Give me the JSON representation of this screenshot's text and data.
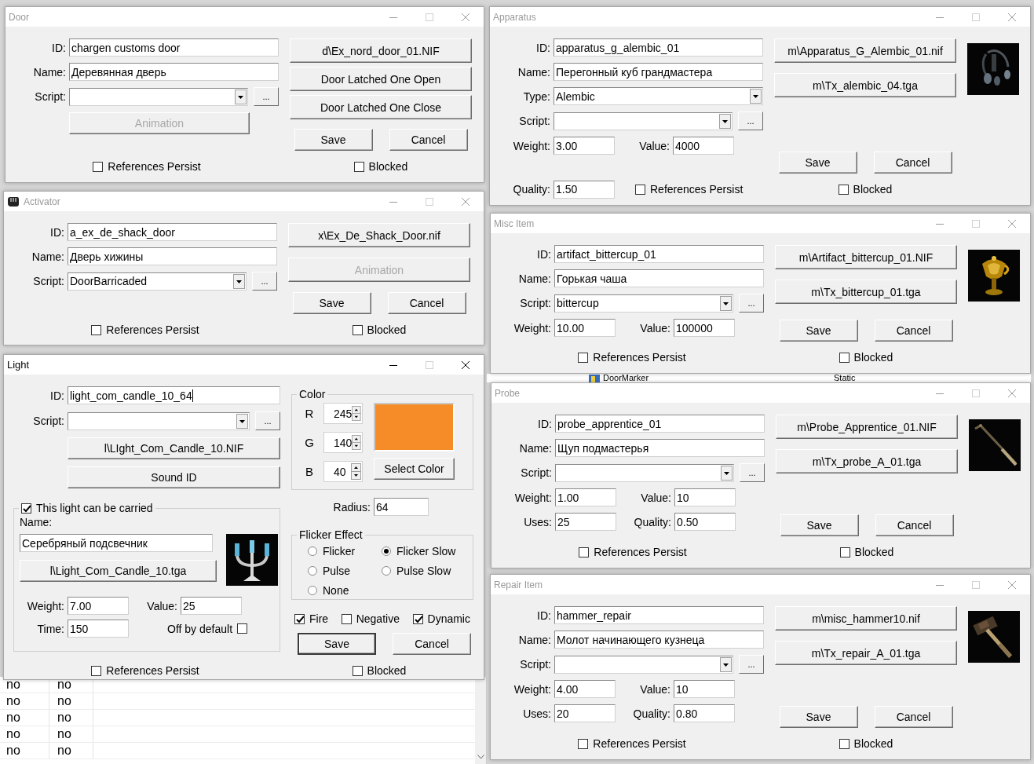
{
  "background": {
    "list_rows": [
      {
        "cells": [
          "no",
          "no"
        ]
      },
      {
        "cells": [
          "no",
          "no"
        ]
      },
      {
        "cells": [
          "no",
          "no"
        ]
      },
      {
        "cells": [
          "no",
          "no"
        ]
      },
      {
        "cells": [
          "no",
          "no"
        ]
      }
    ],
    "strip_row": {
      "cells": [
        "DoorMarker",
        "Static"
      ]
    }
  },
  "windows": [
    {
      "kind": "door",
      "title": "Door",
      "active": false,
      "has_icon": false,
      "left": [
        {
          "kind": "field",
          "label": "ID:",
          "value": "chargen customs door"
        },
        {
          "kind": "field",
          "label": "Name:",
          "value": "Деревянная дверь"
        },
        {
          "kind": "combo",
          "label": "Script:",
          "browse": "..."
        },
        {
          "kind": "button",
          "label": "Animation",
          "disabled": true
        }
      ],
      "right": [
        {
          "kind": "button",
          "label": "d\\Ex_nord_door_01.NIF",
          "disabled": false
        },
        {
          "kind": "button",
          "label": "Door Latched One Open",
          "disabled": false
        },
        {
          "kind": "button",
          "label": "Door Latched One Close",
          "disabled": false
        },
        {
          "kind": "actions",
          "buttons": [
            {
              "label": "Save",
              "default": false
            },
            {
              "label": "Cancel",
              "default": false
            }
          ]
        }
      ],
      "footer": {
        "left": [
          {
            "kind": "check",
            "label": "References Persist",
            "checked": false
          }
        ],
        "right": [
          {
            "kind": "check",
            "label": "Blocked",
            "checked": false
          }
        ]
      }
    },
    {
      "kind": "apparatus",
      "title": "Apparatus",
      "active": false,
      "has_icon": false,
      "left": [
        {
          "kind": "field",
          "label": "ID:",
          "value": "apparatus_g_alembic_01"
        },
        {
          "kind": "field",
          "label": "Name:",
          "value": "Перегонный куб грандмастера"
        },
        {
          "kind": "combo",
          "label": "Type:",
          "value": "Alembic"
        },
        {
          "kind": "combo",
          "label": "Script:",
          "browse": "..."
        },
        {
          "kind": "row",
          "items": [
            {
              "kind": "field",
              "label": "Weight:",
              "value": "3.00"
            },
            {
              "kind": "field",
              "label": "Value:",
              "value": "4000"
            }
          ]
        }
      ],
      "right": [
        {
          "kind": "button",
          "label": "m\\Apparatus_G_Alembic_01.nif",
          "disabled": false
        },
        {
          "kind": "button",
          "label": "m\\Tx_alembic_04.tga",
          "disabled": false
        },
        {
          "kind": "actions",
          "buttons": [
            {
              "label": "Save",
              "default": false
            },
            {
              "label": "Cancel",
              "default": false
            }
          ]
        }
      ],
      "picture": {
        "kind": "picture"
      },
      "footer": {
        "left": [
          {
            "kind": "row",
            "items": [
              {
                "kind": "field",
                "label": "Quality:",
                "value": "1.50"
              },
              {
                "kind": "check",
                "label": "References Persist",
                "checked": false
              }
            ]
          }
        ],
        "right": [
          {
            "kind": "check",
            "label": "Blocked",
            "checked": false
          }
        ]
      }
    },
    {
      "kind": "activator",
      "title": "Activator",
      "active": false,
      "has_icon": true,
      "left": [
        {
          "kind": "field",
          "label": "ID:",
          "value": "a_ex_de_shack_door"
        },
        {
          "kind": "field",
          "label": "Name:",
          "value": "Дверь хижины"
        },
        {
          "kind": "combo",
          "label": "Script:",
          "value": "DoorBarricaded",
          "browse": "..."
        }
      ],
      "right": [
        {
          "kind": "button",
          "label": "x\\Ex_De_Shack_Door.nif",
          "disabled": false
        },
        {
          "kind": "button",
          "label": "Animation",
          "disabled": true
        },
        {
          "kind": "actions",
          "buttons": [
            {
              "label": "Save",
              "default": false
            },
            {
              "label": "Cancel",
              "default": false
            }
          ]
        }
      ],
      "footer": {
        "left": [
          {
            "kind": "check",
            "label": "References Persist",
            "checked": false
          }
        ],
        "right": [
          {
            "kind": "check",
            "label": "Blocked",
            "checked": false
          }
        ]
      }
    },
    {
      "kind": "misc",
      "title": "Misc Item",
      "active": false,
      "has_icon": false,
      "left": [
        {
          "kind": "field",
          "label": "ID:",
          "value": "artifact_bittercup_01"
        },
        {
          "kind": "field",
          "label": "Name:",
          "value": "Горькая чаша"
        },
        {
          "kind": "combo",
          "label": "Script:",
          "value": "bittercup",
          "browse": "..."
        },
        {
          "kind": "row",
          "items": [
            {
              "kind": "field",
              "label": "Weight:",
              "value": "10.00"
            },
            {
              "kind": "field",
              "label": "Value:",
              "value": "100000"
            }
          ]
        }
      ],
      "right": [
        {
          "kind": "button",
          "label": "m\\Artifact_bittercup_01.NIF",
          "disabled": false
        },
        {
          "kind": "button",
          "label": "m\\Tx_bittercup_01.tga",
          "disabled": false
        },
        {
          "kind": "actions",
          "buttons": [
            {
              "label": "Save",
              "default": false
            },
            {
              "label": "Cancel",
              "default": false
            }
          ]
        }
      ],
      "picture": {
        "kind": "picture"
      },
      "footer": {
        "left": [
          {
            "kind": "check",
            "label": "References Persist",
            "checked": false
          }
        ],
        "right": [
          {
            "kind": "check",
            "label": "Blocked",
            "checked": false
          }
        ]
      }
    },
    {
      "kind": "light",
      "title": "Light",
      "active": true,
      "has_icon": false,
      "left": [
        {
          "kind": "field",
          "label": "ID:",
          "value": "light_com_candle_10_64",
          "focused": true
        },
        {
          "kind": "combo",
          "label": "Script:",
          "browse": "..."
        },
        {
          "kind": "button",
          "label": "l\\LIght_Com_Candle_10.NIF",
          "disabled": false
        },
        {
          "kind": "button",
          "label": "Sound ID",
          "disabled": false
        },
        {
          "kind": "group",
          "title": {
            "kind": "check",
            "label": "This light can be carried",
            "checked": true
          },
          "items": [
            {
              "kind": "text",
              "text": "Name:"
            },
            {
              "kind": "row",
              "items": [
                {
                  "kind": "col",
                  "items": [
                    {
                      "kind": "field",
                      "value": "Серебряный подсвечник"
                    },
                    {
                      "kind": "button",
                      "label": "l\\Light_Com_Candle_10.tga",
                      "disabled": false
                    }
                  ]
                },
                {
                  "kind": "picture"
                }
              ]
            },
            {
              "kind": "row",
              "items": [
                {
                  "kind": "field",
                  "label": "Weight:",
                  "value": "7.00"
                },
                {
                  "kind": "field",
                  "label": "Value:",
                  "value": "25"
                }
              ]
            },
            {
              "kind": "row",
              "items": [
                {
                  "kind": "field",
                  "label": "Time:",
                  "value": "150"
                },
                {
                  "kind": "trailing-check",
                  "label": "Off by default",
                  "checked": false
                }
              ]
            }
          ]
        }
      ],
      "right": [
        {
          "kind": "group",
          "title": {
            "kind": "text",
            "text": "Color"
          },
          "items": [
            {
              "kind": "row",
              "items": [
                {
                  "kind": "col",
                  "items": [
                    {
                      "kind": "spin",
                      "label": "R",
                      "value": "245"
                    },
                    {
                      "kind": "spin",
                      "label": "G",
                      "value": "140"
                    },
                    {
                      "kind": "spin",
                      "label": "B",
                      "value": "40"
                    }
                  ]
                },
                {
                  "kind": "col",
                  "items": [
                    {
                      "kind": "swatch",
                      "color": "#f58c28"
                    },
                    {
                      "kind": "button",
                      "label": "Select Color",
                      "disabled": false
                    }
                  ]
                }
              ]
            }
          ]
        },
        {
          "kind": "field",
          "label": "Radius:",
          "value": "64"
        },
        {
          "kind": "group",
          "title": {
            "kind": "text",
            "text": "Flicker Effect"
          },
          "items": [
            {
              "kind": "radio-grid",
              "options": [
                {
                  "label": "Flicker",
                  "selected": false
                },
                {
                  "label": "Flicker Slow",
                  "selected": true
                },
                {
                  "label": "Pulse",
                  "selected": false
                },
                {
                  "label": "Pulse Slow",
                  "selected": false
                },
                {
                  "label": "None",
                  "selected": false
                }
              ]
            }
          ]
        },
        {
          "kind": "row",
          "items": [
            {
              "kind": "check",
              "label": "Fire",
              "checked": true
            },
            {
              "kind": "check",
              "label": "Negative",
              "checked": false
            },
            {
              "kind": "check",
              "label": "Dynamic",
              "checked": true
            }
          ]
        },
        {
          "kind": "actions",
          "buttons": [
            {
              "label": "Save",
              "default": true
            },
            {
              "label": "Cancel",
              "default": false
            }
          ]
        }
      ],
      "footer": {
        "left": [
          {
            "kind": "check",
            "label": "References Persist",
            "checked": false
          }
        ],
        "right": [
          {
            "kind": "check",
            "label": "Blocked",
            "checked": false
          }
        ]
      }
    },
    {
      "kind": "probe",
      "title": "Probe",
      "active": false,
      "has_icon": false,
      "left": [
        {
          "kind": "field",
          "label": "ID:",
          "value": "probe_apprentice_01"
        },
        {
          "kind": "field",
          "label": "Name:",
          "value": "Щуп подмастерья"
        },
        {
          "kind": "combo",
          "label": "Script:",
          "browse": "..."
        },
        {
          "kind": "row",
          "items": [
            {
              "kind": "field",
              "label": "Weight:",
              "value": "1.00"
            },
            {
              "kind": "field",
              "label": "Value:",
              "value": "10"
            }
          ]
        },
        {
          "kind": "row",
          "items": [
            {
              "kind": "field",
              "label": "Uses:",
              "value": "25"
            },
            {
              "kind": "field",
              "label": "Quality:",
              "value": "0.50"
            }
          ]
        }
      ],
      "right": [
        {
          "kind": "button",
          "label": "m\\Probe_Apprentice_01.NIF",
          "disabled": false
        },
        {
          "kind": "button",
          "label": "m\\Tx_probe_A_01.tga",
          "disabled": false
        },
        {
          "kind": "actions",
          "buttons": [
            {
              "label": "Save",
              "default": false
            },
            {
              "label": "Cancel",
              "default": false
            }
          ]
        }
      ],
      "picture": {
        "kind": "picture"
      },
      "footer": {
        "left": [
          {
            "kind": "check",
            "label": "References Persist",
            "checked": false
          }
        ],
        "right": [
          {
            "kind": "check",
            "label": "Blocked",
            "checked": false
          }
        ]
      }
    },
    {
      "kind": "repair",
      "title": "Repair Item",
      "active": false,
      "has_icon": false,
      "left": [
        {
          "kind": "field",
          "label": "ID:",
          "value": "hammer_repair"
        },
        {
          "kind": "field",
          "label": "Name:",
          "value": "Молот начинающего кузнеца"
        },
        {
          "kind": "combo",
          "label": "Script:",
          "browse": "..."
        },
        {
          "kind": "row",
          "items": [
            {
              "kind": "field",
              "label": "Weight:",
              "value": "4.00"
            },
            {
              "kind": "field",
              "label": "Value:",
              "value": "10"
            }
          ]
        },
        {
          "kind": "row",
          "items": [
            {
              "kind": "field",
              "label": "Uses:",
              "value": "20"
            },
            {
              "kind": "field",
              "label": "Quality:",
              "value": "0.80"
            }
          ]
        }
      ],
      "right": [
        {
          "kind": "button",
          "label": "m\\misc_hammer10.nif",
          "disabled": false
        },
        {
          "kind": "button",
          "label": "m\\Tx_repair_A_01.tga",
          "disabled": false
        },
        {
          "kind": "actions",
          "buttons": [
            {
              "label": "Save",
              "default": false
            },
            {
              "label": "Cancel",
              "default": false
            }
          ]
        }
      ],
      "picture": {
        "kind": "picture"
      },
      "footer": {
        "left": [
          {
            "kind": "check",
            "label": "References Persist",
            "checked": false
          }
        ],
        "right": [
          {
            "kind": "check",
            "label": "Blocked",
            "checked": false
          }
        ]
      }
    }
  ]
}
